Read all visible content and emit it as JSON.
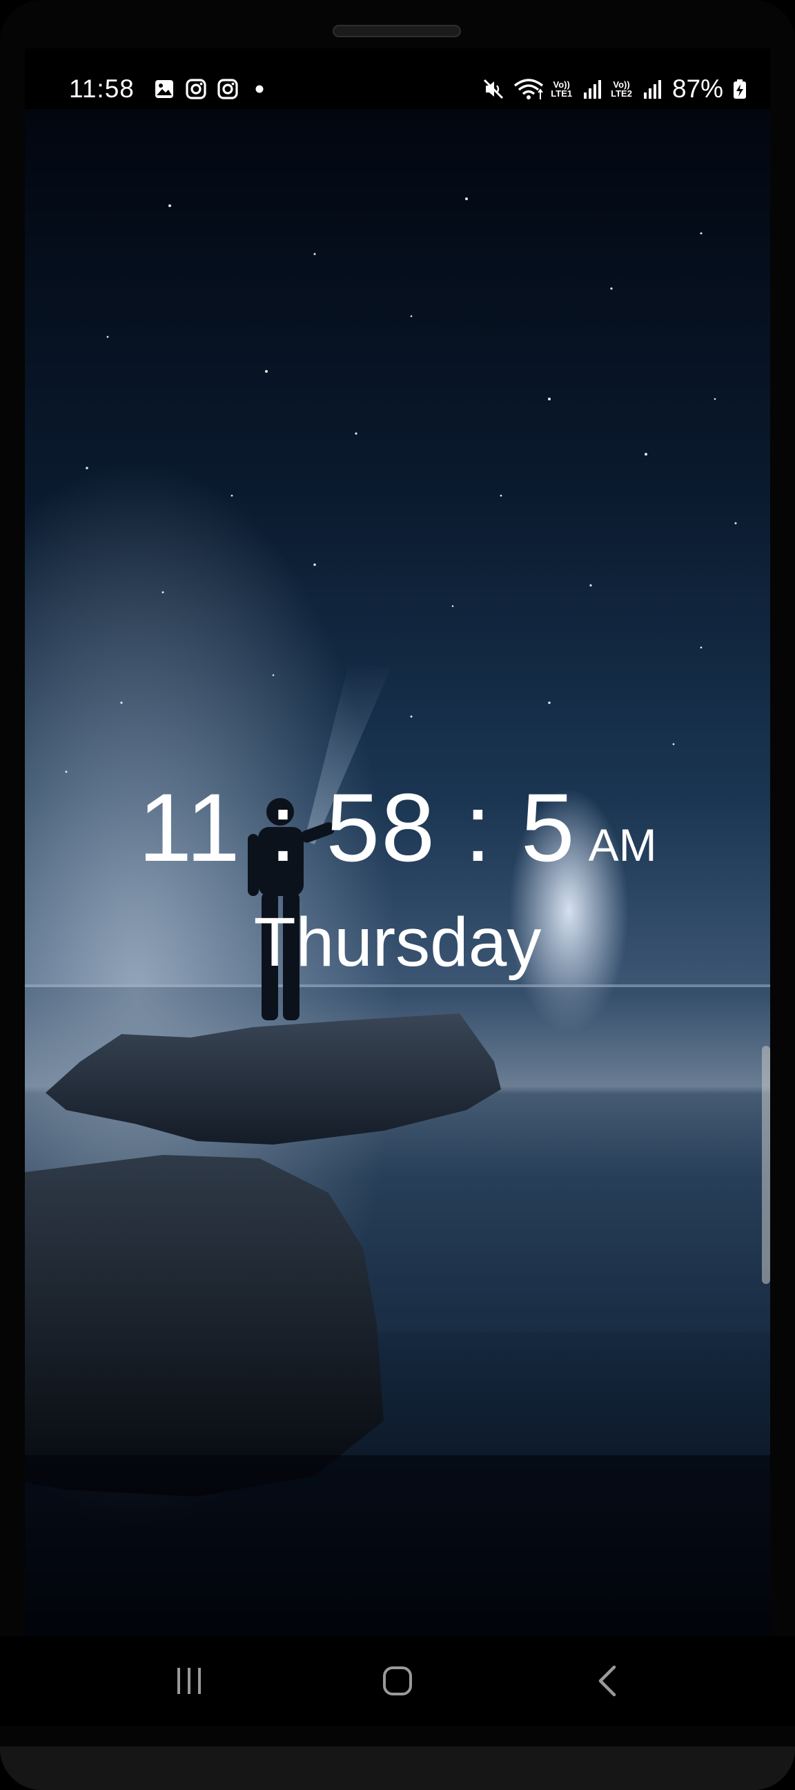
{
  "status_bar": {
    "time": "11:58",
    "notification_icons": [
      "gallery-icon",
      "instagram-icon",
      "instagram-icon",
      "dot-icon"
    ],
    "right_icons": [
      "mute-icon",
      "wifi-icon",
      "signal-sim1-icon",
      "signal-sim2-icon",
      "battery-charging-icon"
    ],
    "sim1_label_top": "Vo))",
    "sim1_label_bottom": "LTE1",
    "sim2_label_top": "Vo))",
    "sim2_label_bottom": "LTE2",
    "battery": "87%"
  },
  "clock": {
    "time": "11 : 58 : 5",
    "ampm": "AM",
    "day": "Thursday"
  },
  "wallpaper": {
    "description_icon": "night-seascape-wallpaper"
  },
  "nav_bar": {
    "buttons": [
      "recents-icon",
      "home-icon",
      "back-icon"
    ]
  },
  "colors": {
    "text": "#ffffff",
    "sky_top": "#030914",
    "sky_mid": "#1b3552",
    "horizon": "#7f95ad",
    "sea": "#243b55",
    "rock": "#2b3644"
  }
}
